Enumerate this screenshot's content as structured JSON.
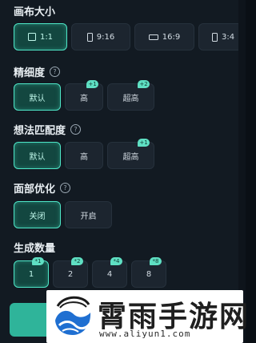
{
  "canvas_size": {
    "title": "画布大小",
    "options": [
      {
        "label": "1:1",
        "icon": "square-ratio-icon",
        "selected": true
      },
      {
        "label": "9:16",
        "icon": "portrait-ratio-icon",
        "selected": false
      },
      {
        "label": "16:9",
        "icon": "landscape-ratio-icon",
        "selected": false
      },
      {
        "label": "3:4",
        "icon": "portrait-ratio-icon",
        "selected": false
      }
    ]
  },
  "fineness": {
    "title": "精细度",
    "options": [
      {
        "label": "默认",
        "selected": true
      },
      {
        "label": "高",
        "badge": "+1",
        "selected": false
      },
      {
        "label": "超高",
        "badge": "+2",
        "selected": false
      }
    ]
  },
  "idea_match": {
    "title": "想法匹配度",
    "options": [
      {
        "label": "默认",
        "selected": true
      },
      {
        "label": "高",
        "selected": false
      },
      {
        "label": "超高",
        "badge": "+1",
        "selected": false
      }
    ]
  },
  "face_opt": {
    "title": "面部优化",
    "options": [
      {
        "label": "关闭",
        "selected": true
      },
      {
        "label": "开启",
        "selected": false
      }
    ]
  },
  "gen_count": {
    "title": "生成数量",
    "options": [
      {
        "label": "1",
        "badge": "*1",
        "selected": true
      },
      {
        "label": "2",
        "badge": "*2",
        "selected": false
      },
      {
        "label": "4",
        "badge": "*4",
        "selected": false
      },
      {
        "label": "8",
        "badge": "*8",
        "selected": false
      }
    ]
  },
  "watermark": {
    "title": "霄雨手游网",
    "url": "www.aliyun1.com"
  },
  "colors": {
    "accent": "#4ee6c7",
    "selected_bg": "#134740",
    "panel_bg": "#121a22",
    "option_bg": "#1c252f"
  }
}
